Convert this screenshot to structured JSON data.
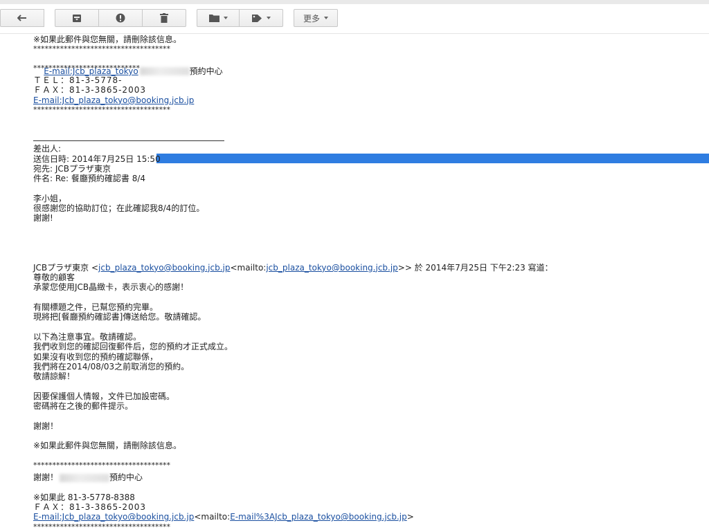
{
  "toolbar": {
    "back_icon": "reply-arrow-icon",
    "archive_icon": "archive-icon",
    "spam_icon": "report-spam-icon",
    "delete_icon": "trash-icon",
    "folder_icon": "folder-icon",
    "label_icon": "tag-icon",
    "more_label": "更多"
  },
  "quoted_top": {
    "disclaimer": "※如果此郵件與您無關，請刪除該信息。",
    "stars": "************************************",
    "email_partial": "E-mail:Jcb_plaza_tokyo",
    "center_name": "預約中心",
    "stars2": "****************************",
    "tel_partial": "ＴＥＬ：81-3-5778-",
    "fax": "ＦＡＸ：81-3-3865-2003",
    "email": "E-mail:Jcb_plaza_tokyo@booking.jcb.jp",
    "stars3": "************************************"
  },
  "header": {
    "from_label": "差出人:",
    "sent_label": "送信日時: 2014年7月25日 15:50",
    "to_label": "宛先: JCBプラザ東京",
    "subject_label": "件名: Re: 餐廳預約確認書 8/4"
  },
  "reply": {
    "greeting": "李小姐，",
    "body1": "很感謝您的協助訂位；在此確認我8/4的訂位。",
    "thanks": "謝謝!"
  },
  "original": {
    "sender_prefix": "JCBプラザ東京 <",
    "sender_email": "jcb_plaza_tokyo@booking.jcb.jp",
    "mailto_prefix": "<mailto:",
    "mailto_email": "jcb_plaza_tokyo@booking.jcb.jp",
    "sender_suffix": ">> 於 2014年7月25日 下午2:23 寫道：",
    "l1": "尊敬的顧客",
    "l2": "承蒙您使用JCB晶緻卡，表示衷心的感謝！",
    "l3": "有關標題之件，已幫您預約完畢。",
    "l4": "現將把[餐廳預約確認書]傳送給您。敬請確認。",
    "l5": "以下為注意事宜。敬請確認。",
    "l6": "我們收到您的確認回復郵件后，您的預約才正式成立。",
    "l7": "如果沒有收到您的預約確認聯係，",
    "l8": "我們將在2014/08/03之前取消您的預約。",
    "l9": "敬請諒解！",
    "l10": "因要保護個人情報，文件已加設密碼。",
    "l11": "密碼將在之後的郵件提示。",
    "l12": "謝謝！",
    "l13": "※如果此郵件與您無關，請刪除該信息。",
    "stars": "************************************",
    "sig1": "謝謝！",
    "sig1_tail": "預約中心",
    "sig2": "※如果此 81-3-5778-8388",
    "fax": "ＦＡＸ：81-3-3865-2003",
    "email": "E-mail:Jcb_plaza_tokyo@booking.jcb.jp",
    "email_mailto_prefix": "<mailto:",
    "email_mailto": "E-mail%3AJcb_plaza_tokyo@booking.jcb.jp",
    "email_mailto_suffix": ">",
    "stars_end": "************************************"
  }
}
